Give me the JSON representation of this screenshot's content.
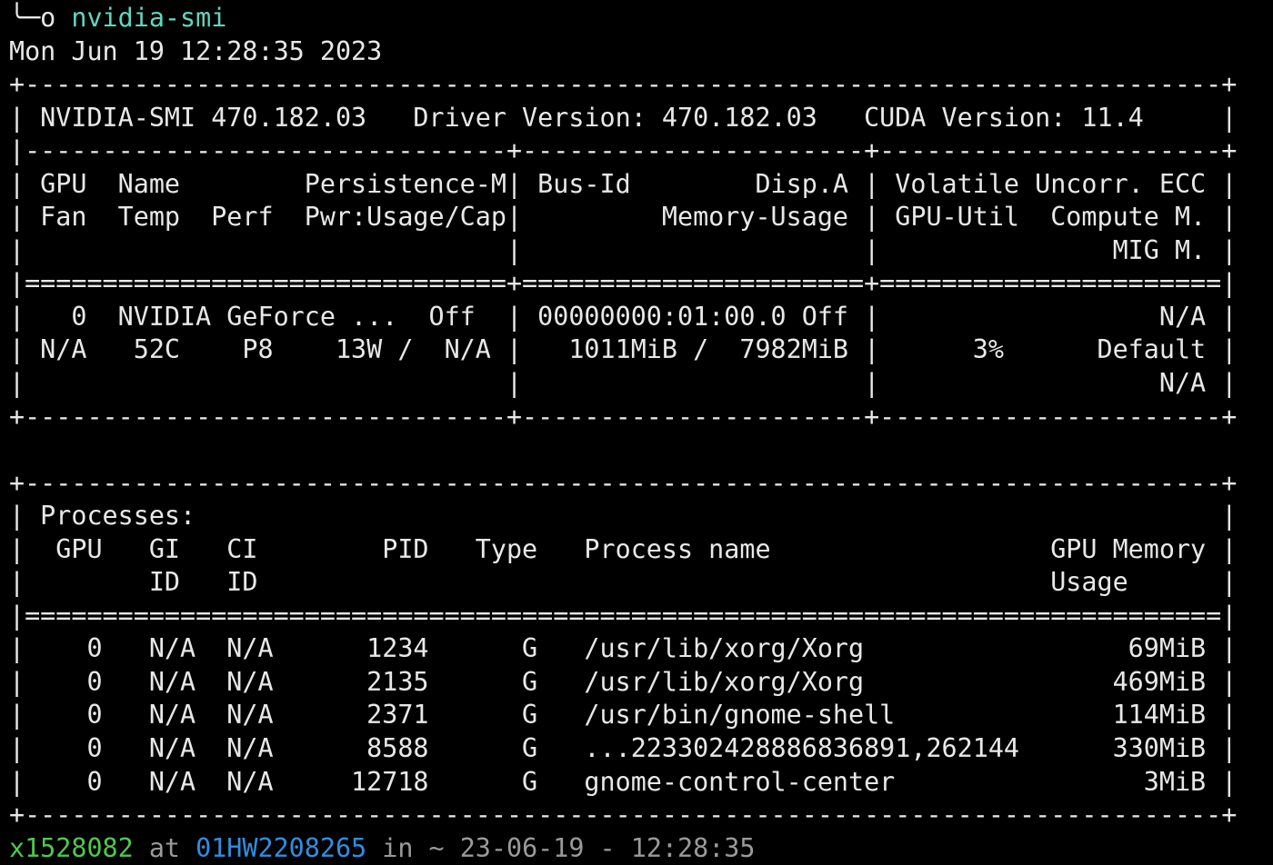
{
  "terminal": {
    "command_line": {
      "prompt_glyph": "╰─o",
      "command": "nvidia-smi"
    },
    "lines": [
      "Mon Jun 19 12:28:35 2023",
      "+-----------------------------------------------------------------------------+",
      "| NVIDIA-SMI 470.182.03   Driver Version: 470.182.03   CUDA Version: 11.4     |",
      "|-------------------------------+----------------------+----------------------+",
      "| GPU  Name        Persistence-M| Bus-Id        Disp.A | Volatile Uncorr. ECC |",
      "| Fan  Temp  Perf  Pwr:Usage/Cap|         Memory-Usage | GPU-Util  Compute M. |",
      "|                               |                      |               MIG M. |",
      "|===============================+======================+======================|",
      "|   0  NVIDIA GeForce ...  Off  | 00000000:01:00.0 Off |                  N/A |",
      "| N/A   52C    P8    13W /  N/A |   1011MiB /  7982MiB |      3%      Default |",
      "|                               |                      |                  N/A |",
      "+-------------------------------+----------------------+----------------------+",
      "",
      "+-----------------------------------------------------------------------------+",
      "| Processes:                                                                  |",
      "|  GPU   GI   CI        PID   Type   Process name                  GPU Memory |",
      "|        ID   ID                                                   Usage      |",
      "|=============================================================================|",
      "|    0   N/A  N/A      1234      G   /usr/lib/xorg/Xorg                 69MiB |",
      "|    0   N/A  N/A      2135      G   /usr/lib/xorg/Xorg                469MiB |",
      "|    0   N/A  N/A      2371      G   /usr/bin/gnome-shell              114MiB |",
      "|    0   N/A  N/A      8588      G   ...223302428886836891,262144      330MiB |",
      "|    0   N/A  N/A     12718      G   gnome-control-center                3MiB |",
      "+-----------------------------------------------------------------------------+"
    ],
    "next_prompt": {
      "user": "x1528082",
      "at": " at ",
      "host": "01HW2208265",
      "rest": " in ~ 23-06-19 - 12:28:35"
    }
  }
}
